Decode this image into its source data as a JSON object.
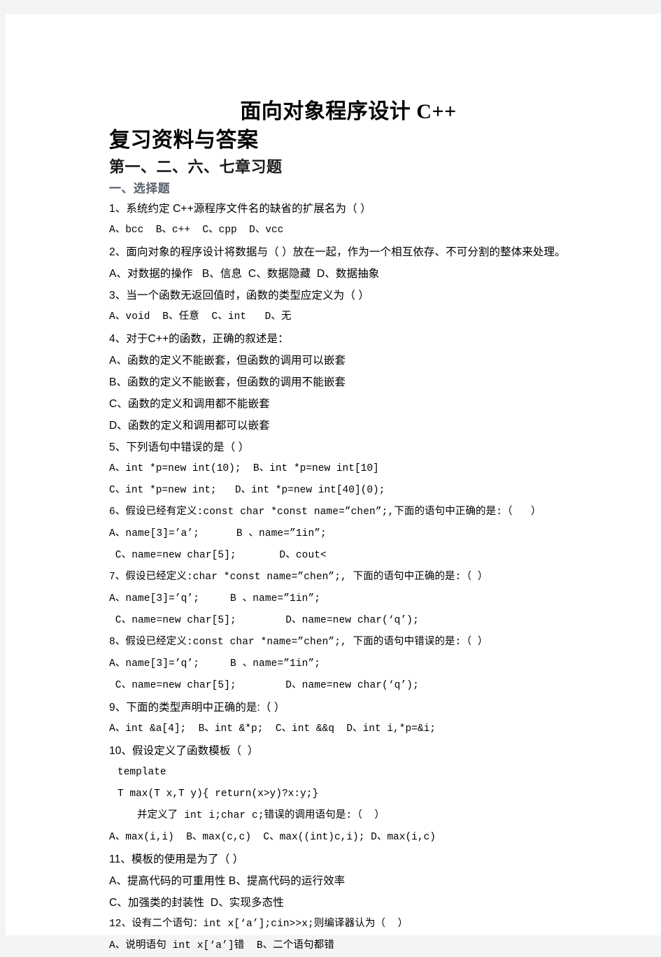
{
  "document": {
    "title_line_1": "面向对象程序设计 C++",
    "title_line_2": "复习资料与答案",
    "chapter_heading": "第一、二、六、七章习题",
    "section_heading": "一、选择题"
  },
  "questions": [
    {
      "id": "q1-stem",
      "text": "1、系统约定 C++源程序文件名的缺省的扩展名为（ ）"
    },
    {
      "id": "q1-opts",
      "text": "A、bcc  B、c++  C、cpp  D、vcc"
    },
    {
      "id": "q2-stem",
      "text": "2、面向对象的程序设计将数据与（ ）放在一起，作为一个相互依存、不可分割的整体来处理。"
    },
    {
      "id": "q2-opts",
      "text": "A、对数据的操作   B、信息  C、数据隐藏  D、数据抽象"
    },
    {
      "id": "q3-stem",
      "text": "3、当一个函数无返回值时，函数的类型应定义为（ ）"
    },
    {
      "id": "q3-opts",
      "text": "A、void  B、任意  C、int   D、无"
    },
    {
      "id": "q4-stem",
      "text": "4、对于C++的函数，正确的叙述是："
    },
    {
      "id": "q4-optA",
      "text": "A、函数的定义不能嵌套，但函数的调用可以嵌套"
    },
    {
      "id": "q4-optB",
      "text": "B、函数的定义不能嵌套，但函数的调用不能嵌套"
    },
    {
      "id": "q4-optC",
      "text": "C、函数的定义和调用都不能嵌套"
    },
    {
      "id": "q4-optD",
      "text": "D、函数的定义和调用都可以嵌套"
    },
    {
      "id": "q5-stem",
      "text": "5、下列语句中错误的是（ ）"
    },
    {
      "id": "q5-optAB",
      "text": "A、int *p=new int(10);  B、int *p=new int[10]"
    },
    {
      "id": "q5-optCD",
      "text": "C、int *p=new int;   D、int *p=new int[40](0);"
    },
    {
      "id": "q6-stem",
      "text": "6、假设已经有定义:const char *const name=”chen”;,下面的语句中正确的是:（   ）"
    },
    {
      "id": "q6-optAB",
      "text": "A、name[3]=’a’;      B 、name=”1in”;"
    },
    {
      "id": "q6-optCD",
      "text": " C、name=new char[5];       D、cout<"
    },
    {
      "id": "q7-stem",
      "text": "7、假设已经定义:char *const name=”chen”;, 下面的语句中正确的是:（ ）"
    },
    {
      "id": "q7-optAB",
      "text": "A、name[3]=’q’;     B 、name=”1in”;"
    },
    {
      "id": "q7-optCD",
      "text": " C、name=new char[5];        D、name=new char(‘q’);"
    },
    {
      "id": "q8-stem",
      "text": "8、假设已经定义:const char *name=”chen”;, 下面的语句中错误的是:（ ）"
    },
    {
      "id": "q8-optAB",
      "text": "A、name[3]=’q’;     B 、name=”1in”;"
    },
    {
      "id": "q8-optCD",
      "text": " C、name=new char[5];        D、name=new char(‘q’);"
    },
    {
      "id": "q9-stem",
      "text": "9、下面的类型声明中正确的是:（ ）"
    },
    {
      "id": "q9-opts",
      "text": "A、int &a[4];  B、int &*p;  C、int &&q  D、int i,*p=&i;"
    },
    {
      "id": "q10-stem",
      "text": "10、假设定义了函数模板（  ）"
    },
    {
      "id": "q10-tpl1",
      "text": "template"
    },
    {
      "id": "q10-tpl2",
      "text": "T max(T x,T y){ return(x>y)?x:y;}"
    },
    {
      "id": "q10-tpl3",
      "text": "并定义了 int i;char c;错误的调用语句是:（  ）"
    },
    {
      "id": "q10-opts",
      "text": "A、max(i,i)  B、max(c,c)  C、max((int)c,i); D、max(i,c)"
    },
    {
      "id": "q11-stem",
      "text": "11、模板的使用是为了（ ）"
    },
    {
      "id": "q11-optAB",
      "text": "A、提高代码的可重用性 B、提高代码的运行效率"
    },
    {
      "id": "q11-optCD",
      "text": "C、加强类的封装性  D、实现多态性"
    },
    {
      "id": "q12-stem",
      "text": "12、设有二个语句：int x[‘a’];cin>>x;则编译器认为（  ）"
    },
    {
      "id": "q12-opts",
      "text": "A、说明语句 int x[‘a’]错  B、二个语句都错"
    }
  ],
  "style": {
    "page_background": "#ffffff",
    "canvas_background": "#f4f4f4",
    "body_text_color": "#000000",
    "section_heading_color": "#5a6070"
  }
}
